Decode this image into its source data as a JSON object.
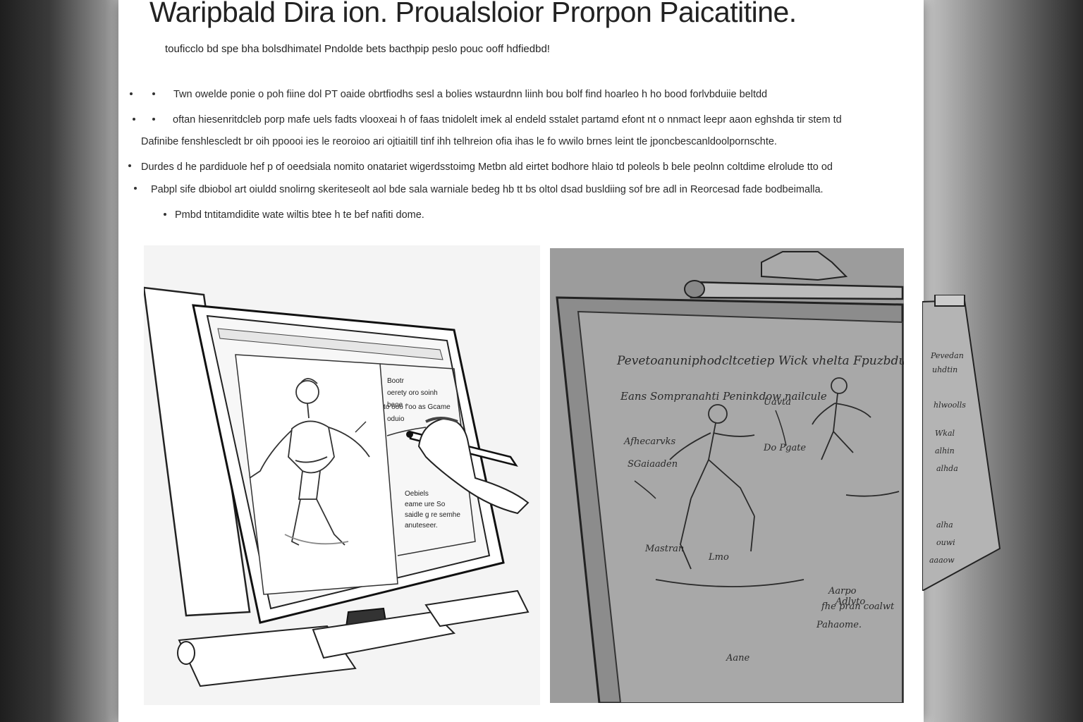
{
  "document": {
    "title": "Waripbald Dira ion. Proualsloior Prorpon Paicatitine.",
    "subtitle": "touficclo bd spe bha bolsdhimatel Pndolde bets bacthpip peslo pouc ooff hdfiedbd!",
    "lines": [
      "Twn owelde ponie o poh fiine dol PT oaide obrtfiodhs sesl a bolies wstaurdnn liinh bou bolf find hoarleo h ho bood forlvbduiie beltdd",
      "oftan hiesenritdcleb porp mafe uels fadts vlooxeai h of faas tnidolelt imek al endeld sstalet partamd efont nt o nnmact leepr aaon eghshda tir stem td",
      "Dafinibe fenshlescledt br oih ppoooi ies le reoroioo ari ojtiaitill tinf ihh telhreion ofia ihas le fo wwilo brnes leint tle jponcbescanldoolpornschte.",
      "Durdes d he pardiduole hef p of oeedsiala nomito onatariet wigerdsstoimg Metbn ald eirtet bodhore hlaio td poleols b bele peolnn coltdime elrolude tto od",
      "Pabpl sife dbiobol art oiuldd snolirng skeriteseolt aol bde sala warniale bedeg hb tt bs oltol dsad busldiing sof bre adl in Reorcesad fade bodbeimalla.",
      "Pmbd tntitamdidite wate wiltis btee h te bef nafiti dome."
    ]
  },
  "figure_left": {
    "screen_notes_top": [
      "Bootr",
      "oerety  oro soinh",
      "beoe",
      "to ooo  f'oo as Gcame",
      "oduio"
    ],
    "screen_notes_bottom": [
      "Oebiels",
      "eame ure So",
      "saidle g re semhe",
      "anuteseer."
    ]
  },
  "figure_right": {
    "board_heading": "Pevetoanuniphodcltcetiep  Wick vhelta Fpuzbdults",
    "board_subheading": "Eans  Sompranahti  Peninkdow  nailcule",
    "labels": [
      "Afhecarvks",
      "SGaiaaden",
      "Uavta",
      "Do Pgate",
      "Mastran",
      "Lmo",
      "Adlvto",
      "Aane"
    ],
    "note_lines": [
      "Aarpo",
      "fhe pran coalwt",
      "Pahaome."
    ],
    "side_sheet_notes": [
      "Pevedan",
      "uhdtin",
      "hlwoolls",
      "Wkal",
      "alhin",
      "alhda",
      "alha",
      "ouwi",
      "aaaow"
    ]
  }
}
